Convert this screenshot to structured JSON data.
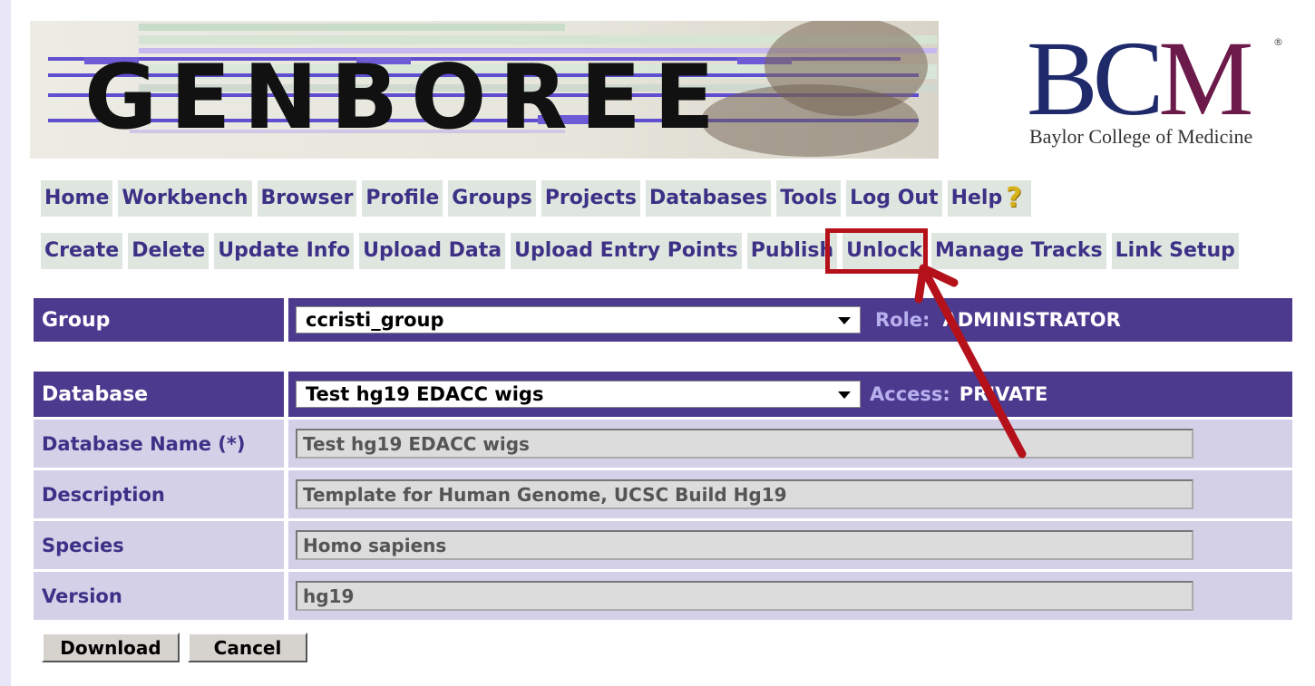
{
  "banner": {
    "logo_text": "GENBOREE"
  },
  "bcm": {
    "letters": "BCM",
    "registered": "®",
    "subtitle": "Baylor College of Medicine"
  },
  "main_menu": [
    "Home",
    "Workbench",
    "Browser",
    "Profile",
    "Groups",
    "Projects",
    "Databases",
    "Tools",
    "Log Out",
    "Help"
  ],
  "help_icon": "question-mark-icon",
  "sub_menu": [
    "Create",
    "Delete",
    "Update Info",
    "Upload Data",
    "Upload Entry Points",
    "Publish",
    "Unlock",
    "Manage Tracks",
    "Link Setup"
  ],
  "group": {
    "label": "Group",
    "selected": "ccristi_group",
    "role_label": "Role:",
    "role_value": "ADMINISTRATOR"
  },
  "database": {
    "label": "Database",
    "selected": "Test hg19 EDACC wigs",
    "access_label": "Access:",
    "access_value": "PRIVATE"
  },
  "fields": [
    {
      "label": "Database Name (*)",
      "value": "Test hg19 EDACC wigs"
    },
    {
      "label": "Description",
      "value": "Template for Human Genome, UCSC Build Hg19"
    },
    {
      "label": "Species",
      "value": "Homo sapiens"
    },
    {
      "label": "Version",
      "value": "hg19"
    }
  ],
  "buttons": {
    "download": "Download",
    "cancel": "Cancel"
  },
  "colors": {
    "header": "#4c3a8f",
    "menu_bg": "#dfe6e0",
    "menu_text": "#3c3186",
    "highlight": "#b4111a"
  }
}
